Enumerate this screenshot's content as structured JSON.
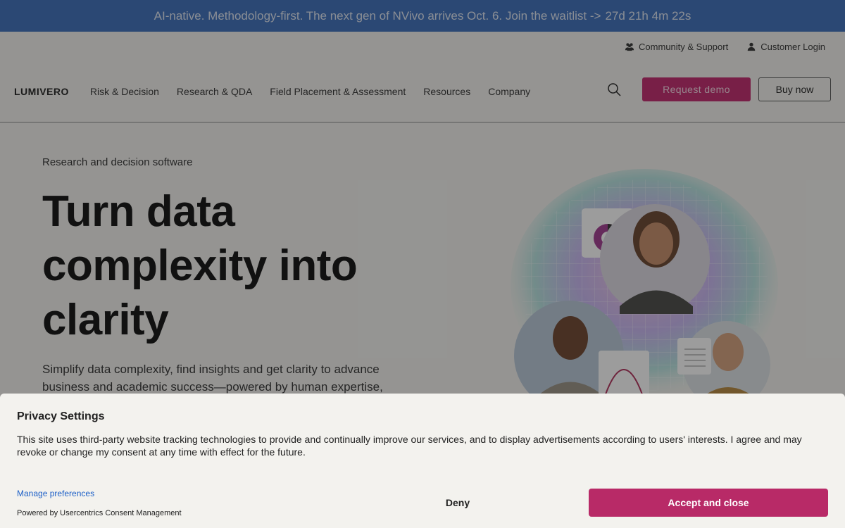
{
  "announcement": {
    "text": "AI-native. Methodology-first. The next gen of NVivo arrives Oct. 6. Join the waitlist ->",
    "countdown": "27d 21h 4m 22s"
  },
  "utility": {
    "community": "Community & Support",
    "login": "Customer Login"
  },
  "nav": {
    "logo": "LUMIVERO",
    "items": [
      "Risk & Decision",
      "Research & QDA",
      "Field Placement & Assessment",
      "Resources",
      "Company"
    ],
    "demo_label": "Request demo",
    "buy_label": "Buy now"
  },
  "hero": {
    "eyebrow": "Research and decision software",
    "title": "Turn data complexity into clarity",
    "subtitle": "Simplify data complexity, find insights and get clarity to advance business and academic success—powered by human expertise,"
  },
  "consent": {
    "title": "Privacy Settings",
    "body": "This site uses third-party website tracking technologies to provide and continually improve our services, and to display advertisements according to users' interests. I agree and may revoke or change my consent at any time with effect for the future.",
    "manage_label": "Manage preferences",
    "powered_by": "Powered by Usercentrics Consent Management",
    "deny_label": "Deny",
    "accept_label": "Accept and close"
  },
  "colors": {
    "announce_bg": "#3d6fbb",
    "brand_pink": "#c2286d",
    "accept_bg": "#b82a67",
    "link": "#1a5ec7"
  }
}
